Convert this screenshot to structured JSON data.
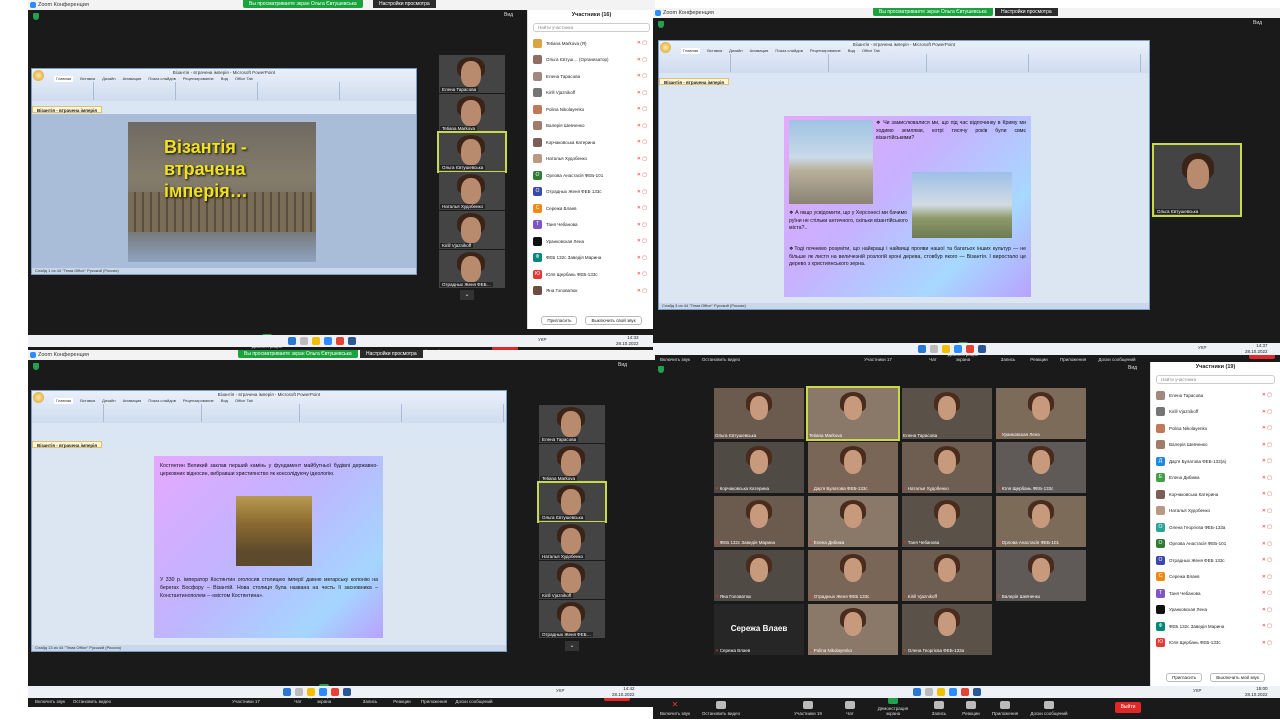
{
  "app": {
    "window_title": "Zoom Конференция",
    "share_banner": "Вы просматриваете экран Ольга Євтушевська",
    "view_options": "Настройки просмотра",
    "view_label": "Вид"
  },
  "toolbar": {
    "mute": "Включить звук",
    "video": "Остановить видео",
    "participants": "Участники",
    "chat": "Чат",
    "share": "Демонстрация экрана",
    "record": "Запись",
    "reactions": "Реакции",
    "apps": "Приложения",
    "whiteboard": "Доски сообщений",
    "leave": "Выйти"
  },
  "ppt": {
    "title_bar": "Візантія - втрачена імперія - Microsoft PowerPoint",
    "tabs": [
      "Главная",
      "Вставка",
      "Дизайн",
      "Анимация",
      "Показ слайдов",
      "Рецензирование",
      "Вид",
      "Office Tab"
    ],
    "doc_tab": "Візантія - втрачена імперія",
    "status_q1": "Слайд 1 из 44   \"Тема Office\"   Русский (Россия)",
    "status_q2": "Слайд 3 из 44   \"Тема Office\"   Русский (Россия)",
    "status_q3": "Слайд 13 из 44   \"Тема Office\"   Русский (Россия)"
  },
  "slides": {
    "s1_title": "Візантія - втрачена імперія…",
    "s2_q1": "❖ Чи замислювалися ми, що під час відпочинку в Криму ми ходимо землями, котрі тисячу років були свмє візантійськими?",
    "s2_q2": "❖ А якщо усвідомити, що у Херсонесі ми бачимо руїни не стільки античного, скільки візантійського міста?..",
    "s2_q3": "❖Тоді почнемо розуміти, що найкращі і найвищі прояви нашої та багатьох інших культур — не більше як листя на величезній розлогій кроні дерева, стовбур якого — Візантія. І виростало це дерево з християнського зерна.",
    "s3_p1": "Костянтин Великий заклав перший камінь у фундамент майбутньої будівлі державно-церковних відносин, вибравши християнство як консолідуючу ідеологію.",
    "s3_p2": "У 330 р. імператор Костянтин оголосив столицею імперії давню мегарську колонію на берегах Босфору – Візантій. Нова столиця була названа на честь її засновника – Константинополем – «містом Костянтина»."
  },
  "q1": {
    "participant_count": "16",
    "participants_title": "Участники (16)",
    "search_placeholder": "Найти участника",
    "strip": [
      {
        "name": "Елена Тарасова"
      },
      {
        "name": "Tetiana Markova"
      },
      {
        "name": "Ольга Євтушевська",
        "active": true
      },
      {
        "name": "Наталья Худобенко"
      },
      {
        "name": "Kirill Vjaznikoff"
      },
      {
        "name": "Отрадных Женя ФЕБ…"
      }
    ],
    "list": [
      {
        "name": "Tetiana Markova (Я)",
        "color": "#d9a441",
        "initial": ""
      },
      {
        "name": "Ольга Євтуш… (Организатор)",
        "color": "#8d6e63",
        "initial": ""
      },
      {
        "name": "Елена Тарасова",
        "color": "#a1887f",
        "initial": ""
      },
      {
        "name": "Kirill Vjaznikoff",
        "color": "#757575",
        "initial": ""
      },
      {
        "name": "Polina Nikolayenko",
        "color": "#c07a5a",
        "initial": ""
      },
      {
        "name": "Валерія Шевченко",
        "color": "#9e7b6a",
        "initial": ""
      },
      {
        "name": "Корчаковська Катерина",
        "color": "#7b5e57",
        "initial": ""
      },
      {
        "name": "Наталья Худобенко",
        "color": "#b89a84",
        "initial": ""
      },
      {
        "name": "Орлова Анастасія ФЕБ-101",
        "color": "#2e7d32",
        "initial": "О"
      },
      {
        "name": "Отрадных Женя ФЕБ 133с",
        "color": "#3949ab",
        "initial": "О"
      },
      {
        "name": "Сережа Влаев",
        "color": "#ef8a17",
        "initial": "С"
      },
      {
        "name": "Таня Чебанова",
        "color": "#7e57c2",
        "initial": "Т"
      },
      {
        "name": "Уранковская Лена",
        "color": "#111111",
        "initial": ""
      },
      {
        "name": "ФЕБ 132с Заведія Марина",
        "color": "#00897b",
        "initial": "Ф"
      },
      {
        "name": "Юля Щербань ФЕБ-133с",
        "color": "#e53935",
        "initial": "Ю"
      },
      {
        "name": "Яна Головатюк",
        "color": "#6d4c41",
        "initial": ""
      }
    ],
    "invite": "Пригласить",
    "mute_me": "Выключить свой звук",
    "time": "14:33",
    "date": "28.10.2022",
    "lang": "УКР"
  },
  "q2": {
    "participant_count": "17",
    "strip_name": "Ольга Євтушевська",
    "time": "14:37",
    "date": "28.10.2022",
    "lang": "УКР"
  },
  "q3": {
    "participant_count": "17",
    "strip": [
      {
        "name": "Елена Тарасова"
      },
      {
        "name": "Tetiana Markova"
      },
      {
        "name": "Ольга Євтушевська",
        "active": true
      },
      {
        "name": "Наталья Худобенко"
      },
      {
        "name": "Kirill Vjaznikoff"
      },
      {
        "name": "Отрадных Женя ФЕБ…"
      }
    ],
    "time": "14:42",
    "date": "28.10.2022",
    "lang": "УКР"
  },
  "q4": {
    "participant_count": "19",
    "participants_title": "Участники (19)",
    "search_placeholder": "Найти участника",
    "grid": [
      {
        "name": "Ольга Євтушевська",
        "muted": false
      },
      {
        "name": "Tetiana Markova",
        "muted": false,
        "active": true
      },
      {
        "name": "Елена Тарасова",
        "muted": false
      },
      {
        "name": "Уранковская Лена",
        "muted": true
      },
      {
        "name": "Корчаковська Катерина",
        "muted": true
      },
      {
        "name": "Дар'я Булатова ФЕБ-133с",
        "muted": true
      },
      {
        "name": "Наталья Худобенко",
        "muted": true
      },
      {
        "name": "Юля Щербань ФЕБ-133с",
        "muted": true
      },
      {
        "name": "ФЕБ 132с Заведія Марина",
        "muted": true
      },
      {
        "name": "Елена Дибижа",
        "muted": true
      },
      {
        "name": "Таня Чебанова",
        "muted": true
      },
      {
        "name": "Орлова Анастасія ФЕБ-101",
        "muted": true
      },
      {
        "name": "Яна Головатюк",
        "muted": true
      },
      {
        "name": "Отрадных Женя ФЕБ 133с",
        "muted": true
      },
      {
        "name": "Kirill Vjaznikoff",
        "muted": true
      },
      {
        "name": "Валерія Шевченко",
        "muted": true
      },
      {
        "name": "Сережа Влаев",
        "muted": true,
        "text_only": "Сережа Влаев"
      },
      {
        "name": "Polina Nikolayenko",
        "muted": true
      },
      {
        "name": "Олена Георгієва ФЕБ-133а",
        "muted": true
      }
    ],
    "list": [
      {
        "name": "Елена Тарасова",
        "color": "#a1887f",
        "initial": ""
      },
      {
        "name": "Kirill Vjaznikoff",
        "color": "#757575",
        "initial": ""
      },
      {
        "name": "Polina Nikolayenko",
        "color": "#c07a5a",
        "initial": ""
      },
      {
        "name": "Валерія Шевченко",
        "color": "#9e7b6a",
        "initial": ""
      },
      {
        "name": "Дар'я Булатова ФЕБ-133(а)",
        "color": "#1e88e5",
        "initial": "Д"
      },
      {
        "name": "Елена Дибижа",
        "color": "#43a047",
        "initial": "Е"
      },
      {
        "name": "Корчаковська Катерина",
        "color": "#7b5e57",
        "initial": ""
      },
      {
        "name": "Наталья Худобенко",
        "color": "#b89a84",
        "initial": ""
      },
      {
        "name": "Олена Георгієва ФЕБ-133а",
        "color": "#26a69a",
        "initial": "О"
      },
      {
        "name": "Орлова Анастасія ФЕБ-101",
        "color": "#2e7d32",
        "initial": "О"
      },
      {
        "name": "Отрадных Женя ФЕБ 133с",
        "color": "#3949ab",
        "initial": "О"
      },
      {
        "name": "Сережа Влаев",
        "color": "#ef8a17",
        "initial": "С"
      },
      {
        "name": "Таня Чебанова",
        "color": "#7e57c2",
        "initial": "Т"
      },
      {
        "name": "Уранковская Лена",
        "color": "#111111",
        "initial": ""
      },
      {
        "name": "ФЕБ 132с Заведія Марина",
        "color": "#00897b",
        "initial": "Ф"
      },
      {
        "name": "Юля Щербань ФЕБ-133с",
        "color": "#e53935",
        "initial": "Ю"
      }
    ],
    "invite": "Пригласить",
    "mute_me": "Выключить мой звук",
    "time": "15:00",
    "date": "28.10.2022",
    "lang": "УКР"
  },
  "colors": {
    "leave": "#e02828",
    "share_green": "#1aa33c",
    "active_outline": "#c8d94a",
    "muted_icon": "#e53935"
  },
  "icons": {
    "mic_off": "🎤̸",
    "video": "video-icon",
    "participants": "people-icon",
    "chat": "chat-icon",
    "share": "share-screen-icon",
    "record": "record-icon",
    "reactions": "smile-icon",
    "apps": "apps-icon",
    "whiteboard": "whiteboard-icon"
  }
}
